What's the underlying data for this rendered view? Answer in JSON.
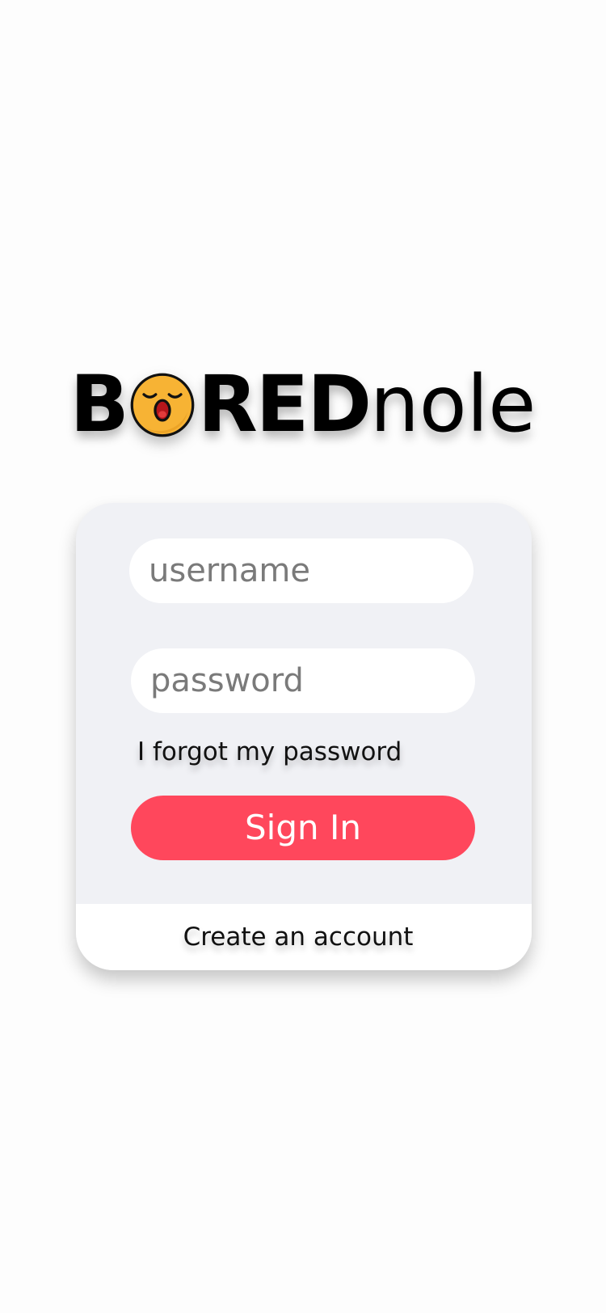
{
  "logo": {
    "bold_first": "B",
    "bold_rest": "RED",
    "light": "nole",
    "emoji_icon": "yawning-face-icon"
  },
  "login": {
    "username_placeholder": "username",
    "password_placeholder": "password",
    "forgot_label": "I forgot my password",
    "signin_label": "Sign In"
  },
  "footer": {
    "create_account_label": "Create an account"
  },
  "colors": {
    "page_background": "#fdfdfd",
    "card_background": "#f0f1f5",
    "signin_button": "#ff475c",
    "emoji_face": "#f7b334",
    "emoji_mouth": "#b5161b"
  }
}
